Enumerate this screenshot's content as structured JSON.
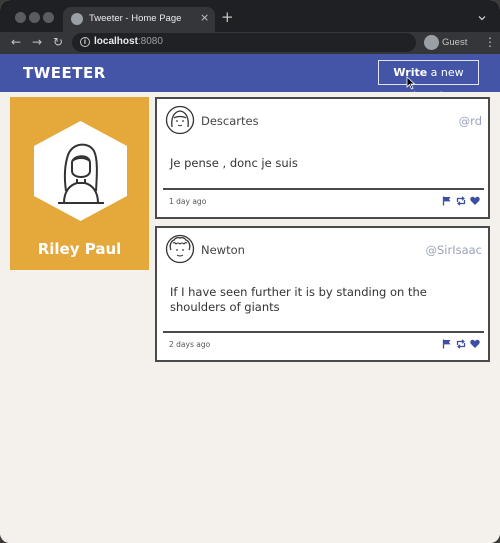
{
  "browser": {
    "tab_title": "Tweeter - Home Page",
    "tab_close": "×",
    "new_tab": "+",
    "url_host": "localhost",
    "url_port": ":8080",
    "profile_label": "Guest",
    "back": "←",
    "forward": "→",
    "reload": "↻",
    "kebab": "⋮"
  },
  "app": {
    "logo": "TWEETER",
    "write_button_strong": "Write",
    "write_button_rest": " a new tweet",
    "accent_color": "#4455a8",
    "card_color": "#e5a83a"
  },
  "profile": {
    "name": "Riley Paul",
    "avatar_icon": "woman-avatar-icon"
  },
  "tweets": [
    {
      "author": "Descartes",
      "handle": "@rd",
      "text": "Je pense , donc je suis",
      "time": "1 day ago",
      "avatar_icon": "girl-avatar-icon",
      "actions": [
        "flag-icon",
        "retweet-icon",
        "heart-icon"
      ]
    },
    {
      "author": "Newton",
      "handle": "@SirIsaac",
      "text": "If I have seen further it is by standing on the shoulders of giants",
      "time": "2 days ago",
      "avatar_icon": "curly-hair-avatar-icon",
      "actions": [
        "flag-icon",
        "retweet-icon",
        "heart-icon"
      ]
    }
  ]
}
